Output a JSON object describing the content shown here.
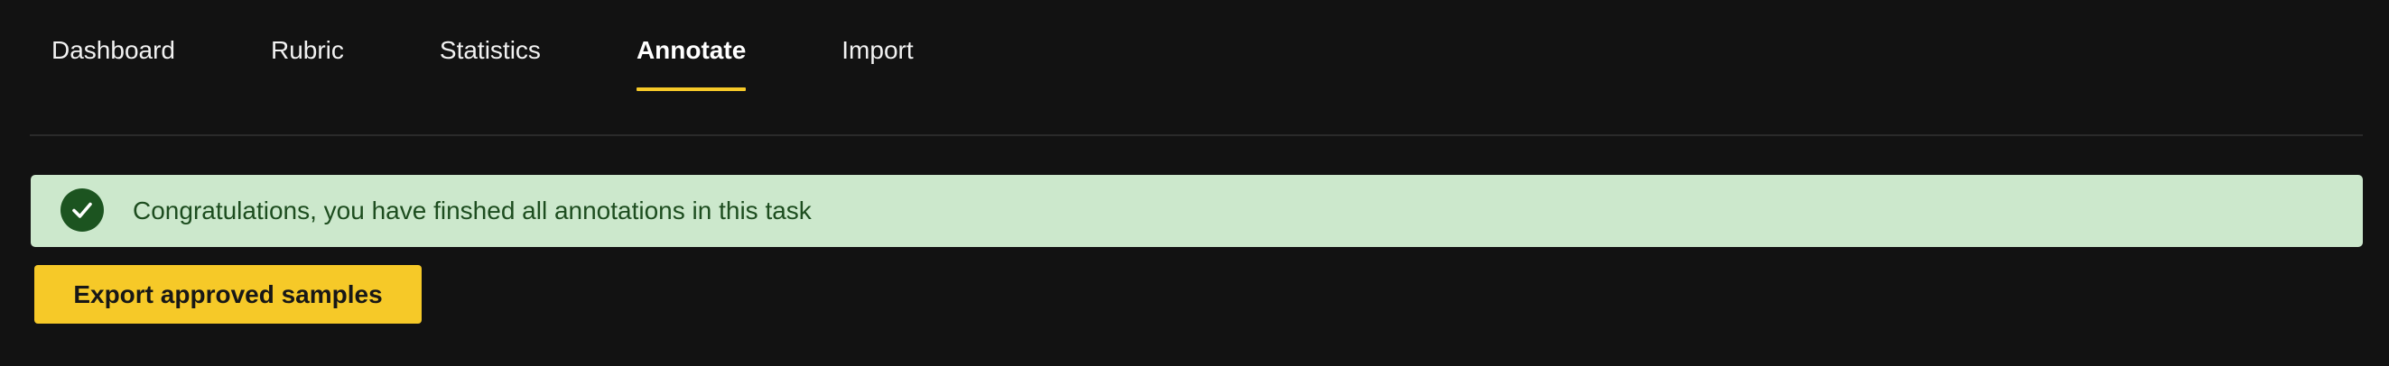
{
  "nav": {
    "tabs": [
      {
        "label": "Dashboard",
        "active": false
      },
      {
        "label": "Rubric",
        "active": false
      },
      {
        "label": "Statistics",
        "active": false
      },
      {
        "label": "Annotate",
        "active": true
      },
      {
        "label": "Import",
        "active": false
      }
    ]
  },
  "alert": {
    "icon": "check-circle-icon",
    "message": "Congratulations, you have finshed all annotations in this task"
  },
  "actions": {
    "export_label": "Export approved samples"
  },
  "colors": {
    "background": "#121212",
    "accent": "#f6c928",
    "success_bg": "#cce8cc",
    "success_fg": "#1d4d1f",
    "success_icon": "#1c5420"
  }
}
